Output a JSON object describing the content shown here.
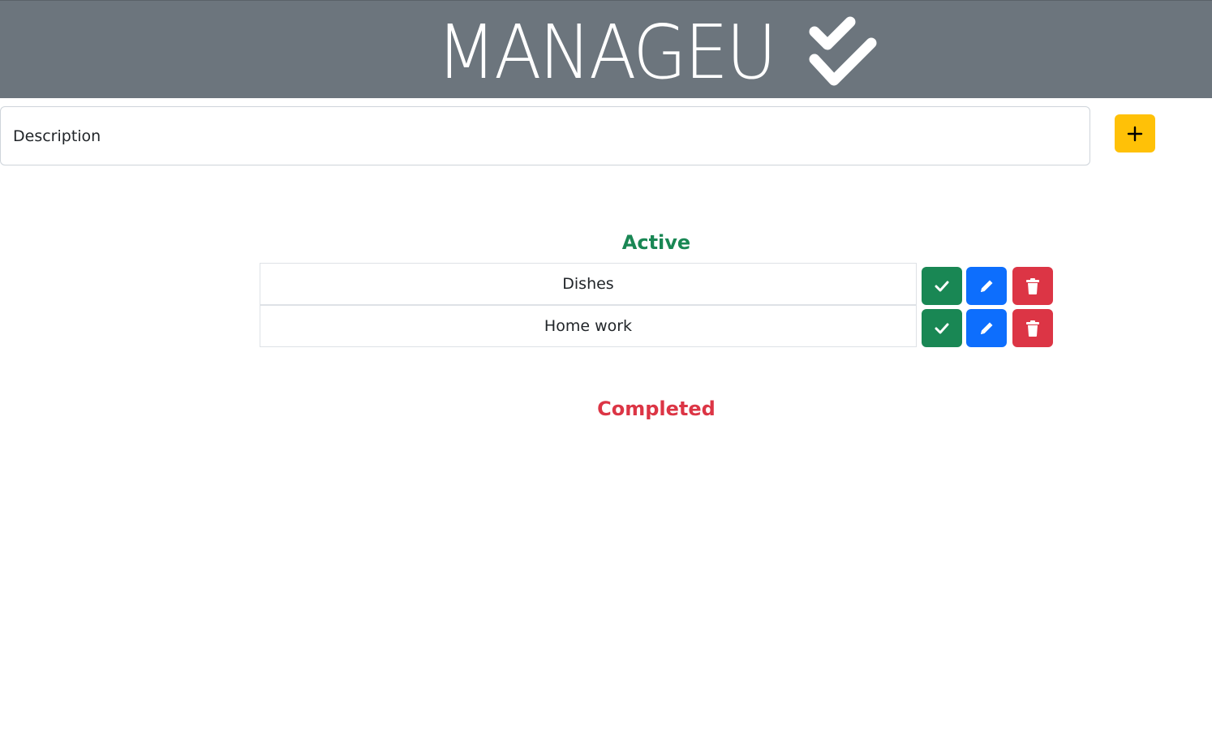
{
  "header": {
    "logo_text": "MANAGEU",
    "background_color": "#6c757d"
  },
  "form": {
    "description_placeholder": "Description",
    "add_button_icon": "plus-icon",
    "add_button_color": "#ffc107"
  },
  "active": {
    "title": "Active",
    "title_color": "#198754",
    "tasks": [
      {
        "label": "Dishes"
      },
      {
        "label": "Home work"
      }
    ],
    "actions": {
      "complete_icon": "check-icon",
      "complete_color": "#198754",
      "edit_icon": "pencil-icon",
      "edit_color": "#0d6efd",
      "delete_icon": "trash-icon",
      "delete_color": "#dc3545"
    }
  },
  "completed": {
    "title": "Completed",
    "title_color": "#dc3545",
    "tasks": []
  }
}
